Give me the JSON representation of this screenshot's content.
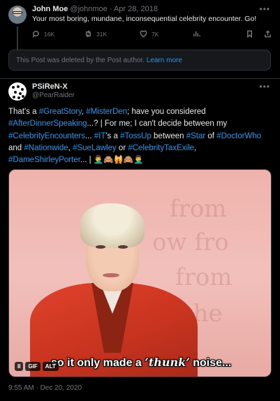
{
  "tweet1": {
    "display_name": "John Moe",
    "handle": "@johnmoe",
    "separator": "·",
    "date": "Apr 28, 2018",
    "more_icon": "more-dots-icon",
    "text": "Your most boring, mundane, inconsequential celebrity encounter. Go!",
    "actions": {
      "replies": "16K",
      "retweets": "31K",
      "likes": "7K"
    },
    "deleted_notice": "This Post was deleted by the Post author.",
    "learn_more": "Learn more"
  },
  "tweet2": {
    "display_name": "PSiReN-X",
    "handle": "@PearRaider",
    "body": [
      {
        "t": "That's a "
      },
      {
        "t": "#GreatStory",
        "h": true
      },
      {
        "t": ", "
      },
      {
        "t": "#MisterDen",
        "h": true
      },
      {
        "t": "; have you considered "
      },
      {
        "t": "#AfterDinnerSpeaking",
        "h": true
      },
      {
        "t": "...? | For me; I can't decide between my "
      },
      {
        "t": "#CelebrityEncounters",
        "h": true
      },
      {
        "t": "... "
      },
      {
        "t": "#IT",
        "h": true
      },
      {
        "t": "'s a "
      },
      {
        "t": "#TossUp",
        "h": true
      },
      {
        "t": " between "
      },
      {
        "t": "#Star",
        "h": true
      },
      {
        "t": " of "
      },
      {
        "t": "#DoctorWho",
        "h": true
      },
      {
        "t": " and "
      },
      {
        "t": "#Nationwide",
        "h": true
      },
      {
        "t": ", "
      },
      {
        "t": "#SueLawley",
        "h": true
      },
      {
        "t": " or "
      },
      {
        "t": "#CelebrityTaxExile",
        "h": true
      },
      {
        "t": ", "
      },
      {
        "t": "#DameShirleyPorter",
        "h": true
      },
      {
        "t": "... | 🤦‍♂️🙈🙀🙈🤦‍♂️"
      }
    ],
    "media": {
      "caption_before": "so it only made a ",
      "caption_em": "‘thunk’",
      "caption_after": " noise...",
      "pause_label": "II",
      "gif_label": "GIF",
      "alt_label": "ALT",
      "background_text": [
        "from",
        "ow fro",
        "from",
        "the"
      ]
    },
    "timestamp": "9:55 AM · Dec 20, 2020"
  },
  "colors": {
    "background": "#000000",
    "text": "#e7e9ea",
    "muted": "#71767b",
    "link": "#1d9bf0",
    "border": "#2f3336"
  }
}
